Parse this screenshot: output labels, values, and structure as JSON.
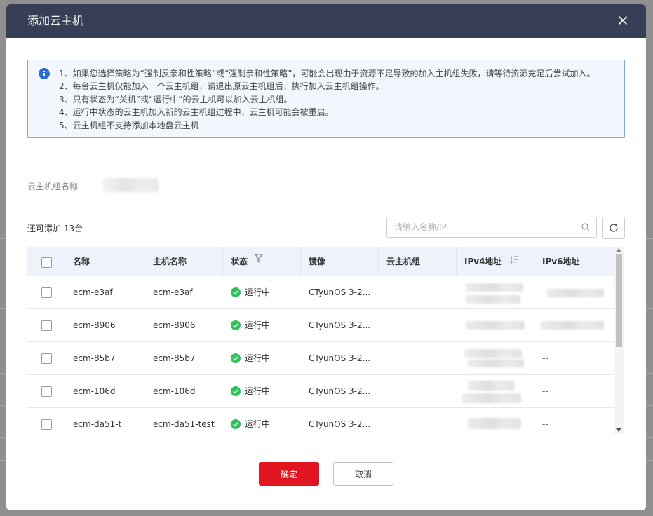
{
  "dialog": {
    "title": "添加云主机",
    "close_icon": "close-icon"
  },
  "notice": {
    "icon": "info-icon",
    "accent_color": "#2a6fd6",
    "lines": [
      "1、如果您选择策略为“强制反亲和性策略”或“强制亲和性策略”，可能会出现由于资源不足导致的加入主机组失败，请等待资源充足后尝试加入。",
      "2、每台云主机仅能加入一个云主机组，请退出原云主机组后，执行加入云主机组操作。",
      "3、只有状态为“关机”或“运行中”的云主机可以加入云主机组。",
      "4、运行中状态的云主机加入新的云主机组过程中，云主机可能会被重启。",
      "5、云主机组不支持添加本地盘云主机"
    ]
  },
  "group": {
    "label": "云主机组名称"
  },
  "toolbar": {
    "remaining_text": "还可添加 13台",
    "search_placeholder": "请输入名称/IP",
    "search_icon": "search-icon",
    "refresh_icon": "refresh-icon"
  },
  "table": {
    "columns": [
      "名称",
      "主机名称",
      "状态",
      "镜像",
      "云主机组",
      "IPv4地址",
      "IPv6地址"
    ],
    "status_filter_icon": "filter-icon",
    "ipv4_sort_icon": "sort-icon",
    "rows": [
      {
        "name": "ecm-e3af",
        "host": "ecm-e3af",
        "status": "运行中",
        "image": "CTyunOS 3-2...",
        "group": "",
        "ipv6": ""
      },
      {
        "name": "ecm-8906",
        "host": "ecm-8906",
        "status": "运行中",
        "image": "CTyunOS 3-2...",
        "group": "",
        "ipv6": ""
      },
      {
        "name": "ecm-85b7",
        "host": "ecm-85b7",
        "status": "运行中",
        "image": "CTyunOS 3-2...",
        "group": "",
        "ipv6": "--"
      },
      {
        "name": "ecm-106d",
        "host": "ecm-106d",
        "status": "运行中",
        "image": "CTyunOS 3-2...",
        "group": "",
        "ipv6": "--"
      },
      {
        "name": "ecm-da51-t",
        "host": "ecm-da51-test",
        "status": "运行中",
        "image": "CTyunOS 3-2...",
        "group": "",
        "ipv6": "--"
      }
    ],
    "status_color": "#2fc25b"
  },
  "footer": {
    "ok_label": "确定",
    "cancel_label": "取消",
    "ok_color": "#e1151f"
  }
}
